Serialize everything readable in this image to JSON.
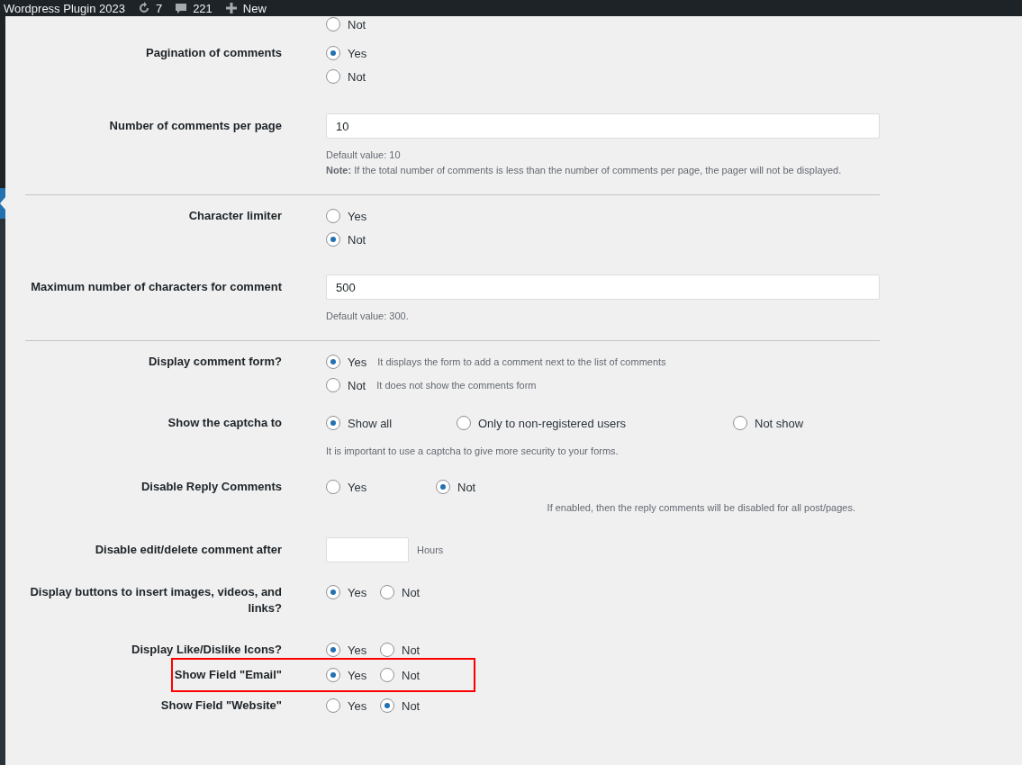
{
  "admin_bar": {
    "site_name": "Wordpress Plugin 2023",
    "updates": "7",
    "comments": "221",
    "new_label": "New"
  },
  "sidebar": {
    "current_item": true
  },
  "rows": [
    {
      "kind": "radio_stack",
      "options": [
        {
          "label": "Not",
          "selected": false
        }
      ]
    },
    {
      "label": "Pagination of comments",
      "kind": "radio_stack",
      "options": [
        {
          "label": "Yes",
          "selected": true
        },
        {
          "label": "Not",
          "selected": false
        }
      ]
    },
    {
      "label": "Number of comments per page",
      "kind": "input",
      "value": "10",
      "notes": [
        {
          "text": "Default value: 10"
        },
        {
          "text": "**Note:** If the total number of comments is less than the number of comments per page, the pager will not be displayed."
        }
      ],
      "divider_after": true
    },
    {
      "label": "Character limiter",
      "kind": "radio_stack",
      "options": [
        {
          "label": "Yes",
          "selected": false
        },
        {
          "label": "Not",
          "selected": true
        }
      ]
    },
    {
      "label": "Maximum number of characters for comment",
      "kind": "input",
      "value": "500",
      "notes": [
        {
          "text": "Default value: 300."
        }
      ],
      "divider_after": true
    },
    {
      "label": "Display comment form?",
      "kind": "radio_stack",
      "options": [
        {
          "label": "Yes",
          "selected": true,
          "note": "It displays the form to add a comment next to the list of comments"
        },
        {
          "label": "Not",
          "selected": false,
          "note": "It does not show the comments form"
        }
      ]
    },
    {
      "label": "Show the captcha to",
      "kind": "radio_spread",
      "options": [
        {
          "label": "Show all",
          "selected": true
        },
        {
          "label": "Only to non-registered users",
          "selected": false
        },
        {
          "label": "Not show",
          "selected": false
        }
      ],
      "notes": [
        {
          "text": "It is important to use a captcha to give more security to your forms."
        }
      ]
    },
    {
      "label": "Disable Reply Comments",
      "kind": "radio_wide",
      "options": [
        {
          "label": "Yes",
          "selected": false
        },
        {
          "label": "Not",
          "selected": true
        }
      ],
      "notes": [
        {
          "text": "If enabled, then the reply comments will be disabled for all post/pages."
        }
      ]
    },
    {
      "label": "Disable edit/delete comment after",
      "kind": "input_small",
      "suffix": "Hours"
    },
    {
      "label": "Display buttons to insert images, videos, and links?",
      "kind": "radio_inline",
      "options": [
        {
          "label": "Yes",
          "selected": true
        },
        {
          "label": "Not",
          "selected": false
        }
      ]
    },
    {
      "label": "Display Like/Dislike Icons?",
      "kind": "radio_inline",
      "options": [
        {
          "label": "Yes",
          "selected": true
        },
        {
          "label": "Not",
          "selected": false
        }
      ]
    },
    {
      "label": "Show Field \"Email\"",
      "kind": "radio_inline",
      "highlighted": true,
      "options": [
        {
          "label": "Yes",
          "selected": true
        },
        {
          "label": "Not",
          "selected": false
        }
      ]
    },
    {
      "label": "Show Field \"Website\"",
      "kind": "radio_inline",
      "options": [
        {
          "label": "Yes",
          "selected": false
        },
        {
          "label": "Not",
          "selected": true
        }
      ]
    }
  ]
}
